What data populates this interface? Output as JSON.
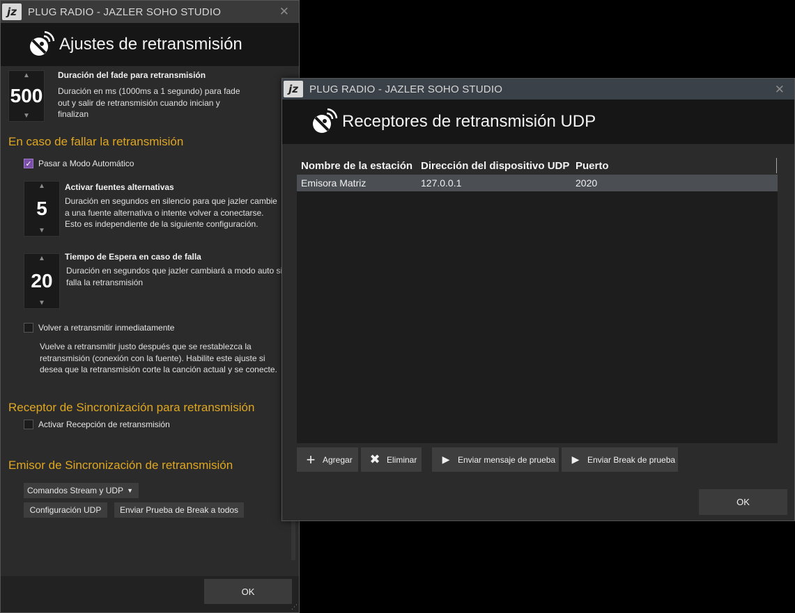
{
  "window1": {
    "title": "PLUG RADIO - JAZLER SOHO STUDIO",
    "logo_text": "jz",
    "close_icon": "close-icon",
    "header": "Ajustes de retransmisión",
    "fade": {
      "value": "500",
      "title": "Duración del fade para retransmisión",
      "desc_lines": [
        "Duración en ms (1000ms a 1 segundo) para fade",
        "out y salir de  retransmisión cuando inician y",
        "finalizan"
      ]
    },
    "fail_section": "En caso de fallar la retransmisión",
    "auto_mode_label": "Pasar a Modo Automático",
    "alt_sources": {
      "value": "5",
      "title": "Activar fuentes alternativas",
      "desc_lines": [
        "Duración en segundos en silencio para que jazler cambie",
        "a una fuente  alternativa o intente volver a conectarse.",
        "Esto es independiente de la siguiente configuración."
      ]
    },
    "wait_time": {
      "value": "20",
      "title": "Tiempo de Espera en caso de falla",
      "desc_lines": [
        "Duración en segundos que jazler cambiará a modo auto si",
        "falla la retransmisión"
      ]
    },
    "retransmit_label": "Volver a retransmitir inmediatamente",
    "retransmit_desc_lines": [
      "Vuelve a retransmitir justo después  que se restablezca la",
      "retransmisión (conexión con la fuente). Habilite este ajuste si",
      "desea que la retransmisión corte la canción actual y se conecte."
    ],
    "receiver_section": "Receptor de Sincronización para retransmisión",
    "receiver_label": "Activar Recepción de retransmisión",
    "emitter_section": "Emisor de Sincronización de retransmisión",
    "dropdown_value": "Comandos Stream y UDP",
    "config_udp": "Configuración UDP",
    "send_break_all": "Enviar Prueba de Break a todos",
    "ok": "OK"
  },
  "window2": {
    "title": "PLUG RADIO - JAZLER SOHO STUDIO",
    "logo_text": "jz",
    "header": "Receptores de retransmisión UDP",
    "columns": [
      "Nombre de la estación",
      "Dirección del dispositivo UDP",
      "Puerto"
    ],
    "rows": [
      {
        "station": "Emisora Matriz",
        "address": "127.0.0.1",
        "port": "2020"
      }
    ],
    "buttons": {
      "add": "Agregar",
      "remove": "Eliminar",
      "send_test_msg": "Enviar mensaje de prueba",
      "send_test_break": "Enviar Break de prueba"
    },
    "ok": "OK"
  },
  "colors": {
    "section_accent": "#e0a720",
    "checkbox_checked": "#7a4fa8"
  }
}
